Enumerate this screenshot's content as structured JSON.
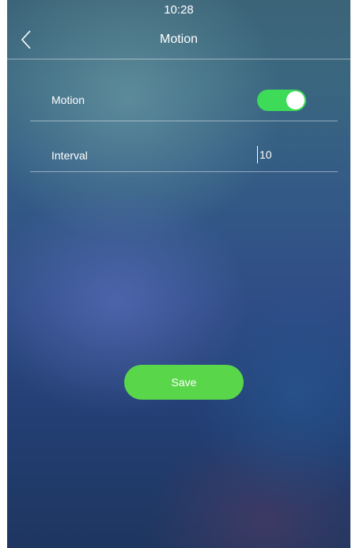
{
  "status_bar": {
    "time": "10:28"
  },
  "header": {
    "title": "Motion",
    "back_icon": "chevron-left-icon"
  },
  "settings": {
    "motion": {
      "label": "Motion",
      "enabled": true
    },
    "interval": {
      "label": "Interval",
      "value": "10"
    }
  },
  "actions": {
    "save_label": "Save"
  },
  "colors": {
    "toggle_on": "#3ddb58",
    "save_button": "#5ad64a",
    "text": "#ffffff"
  }
}
